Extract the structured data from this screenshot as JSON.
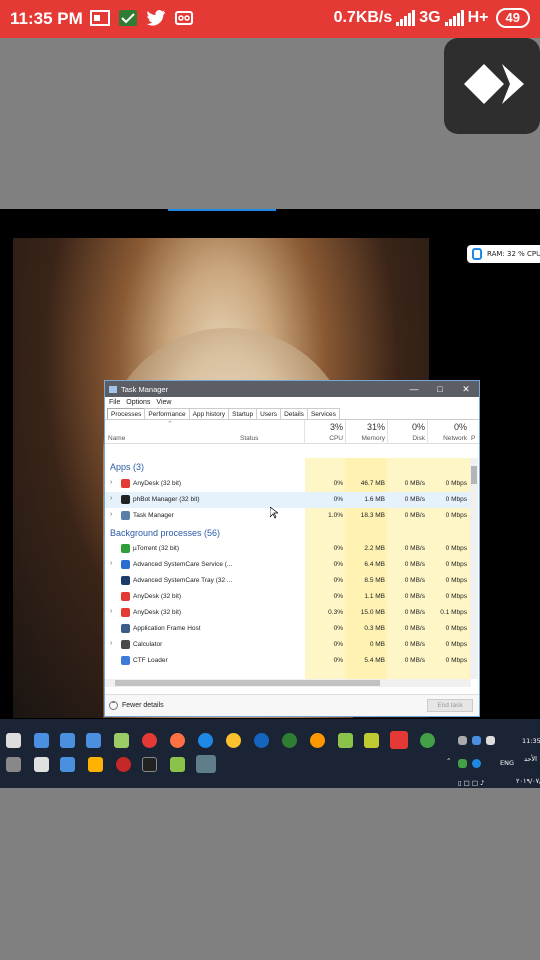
{
  "status_bar": {
    "time": "11:35 PM",
    "speed": "0.7KB/s",
    "network": "3G",
    "network2": "H+",
    "battery": "49"
  },
  "perf_overlay": {
    "text": "RAM: 32 %  CPU:"
  },
  "task_manager": {
    "title": "Task Manager",
    "menu": [
      "File",
      "Options",
      "View"
    ],
    "tabs": [
      "Processes",
      "Performance",
      "App history",
      "Startup",
      "Users",
      "Details",
      "Services"
    ],
    "columns": {
      "name": "Name",
      "status": "Status",
      "cpu_pct": "3%",
      "cpu": "CPU",
      "mem_pct": "31%",
      "memory": "Memory",
      "disk_pct": "0%",
      "disk": "Disk",
      "net_pct": "0%",
      "network": "Network",
      "power": "P"
    },
    "apps_header": "Apps (3)",
    "apps": [
      {
        "name": "AnyDesk (32 bit)",
        "cpu": "0%",
        "mem": "46.7 MB",
        "disk": "0 MB/s",
        "net": "0 Mbps",
        "color": "#e53935"
      },
      {
        "name": "phBot Manager (32 bit)",
        "cpu": "0%",
        "mem": "1.6 MB",
        "disk": "0 MB/s",
        "net": "0 Mbps",
        "color": "#222222"
      },
      {
        "name": "Task Manager",
        "cpu": "1.0%",
        "mem": "18.3 MB",
        "disk": "0 MB/s",
        "net": "0 Mbps",
        "color": "#5a7fa8"
      }
    ],
    "bg_header": "Background processes (56)",
    "bg": [
      {
        "name": "µTorrent (32 bit)",
        "cpu": "0%",
        "mem": "2.2 MB",
        "disk": "0 MB/s",
        "net": "0 Mbps",
        "color": "#2e9e3a",
        "exp": false
      },
      {
        "name": "Advanced SystemCare Service (...",
        "cpu": "0%",
        "mem": "6.4 MB",
        "disk": "0 MB/s",
        "net": "0 Mbps",
        "color": "#2a6fd0",
        "exp": true
      },
      {
        "name": "Advanced SystemCare Tray (32 ...",
        "cpu": "0%",
        "mem": "8.5 MB",
        "disk": "0 MB/s",
        "net": "0 Mbps",
        "color": "#1a3b6b",
        "exp": false
      },
      {
        "name": "AnyDesk (32 bit)",
        "cpu": "0%",
        "mem": "1.1 MB",
        "disk": "0 MB/s",
        "net": "0 Mbps",
        "color": "#e53935",
        "exp": false
      },
      {
        "name": "AnyDesk (32 bit)",
        "cpu": "0.3%",
        "mem": "15.0 MB",
        "disk": "0 MB/s",
        "net": "0.1 Mbps",
        "color": "#e53935",
        "exp": true
      },
      {
        "name": "Application Frame Host",
        "cpu": "0%",
        "mem": "0.3 MB",
        "disk": "0 MB/s",
        "net": "0 Mbps",
        "color": "#3b5b8a",
        "exp": false
      },
      {
        "name": "Calculator",
        "cpu": "0%",
        "mem": "0 MB",
        "disk": "0 MB/s",
        "net": "0 Mbps",
        "color": "#4a4a4a",
        "exp": true
      },
      {
        "name": "CTF Loader",
        "cpu": "0%",
        "mem": "5.4 MB",
        "disk": "0 MB/s",
        "net": "0 Mbps",
        "color": "#3d7bd6",
        "exp": false
      }
    ],
    "fewer_details": "Fewer details",
    "end_task": "End task"
  },
  "taskbar": {
    "lang": "ENG",
    "clock_time": "11:35",
    "clock_day": "الأحد",
    "clock_date": "٢٠١٩/٠٧/٠٧"
  }
}
